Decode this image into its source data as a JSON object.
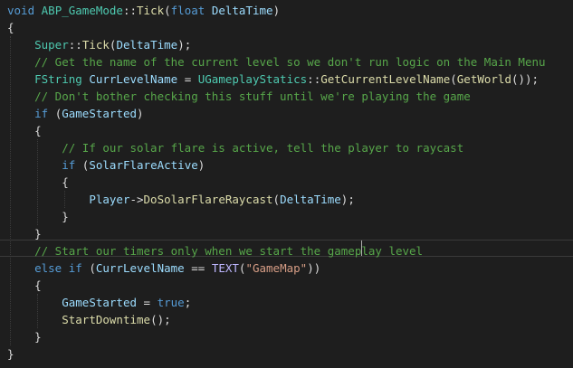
{
  "editor": {
    "cursor_line": 13,
    "lines": [
      [
        {
          "c": "k",
          "t": "void"
        },
        {
          "c": "p",
          "t": " "
        },
        {
          "c": "t",
          "t": "ABP_GameMode"
        },
        {
          "c": "p",
          "t": "::"
        },
        {
          "c": "f",
          "t": "Tick"
        },
        {
          "c": "p",
          "t": "("
        },
        {
          "c": "k",
          "t": "float"
        },
        {
          "c": "p",
          "t": " "
        },
        {
          "c": "v",
          "t": "DeltaTime"
        },
        {
          "c": "p",
          "t": ")"
        }
      ],
      [
        {
          "c": "p",
          "t": "{"
        }
      ],
      [
        {
          "c": "p",
          "t": "    "
        },
        {
          "c": "t",
          "t": "Super"
        },
        {
          "c": "p",
          "t": "::"
        },
        {
          "c": "f",
          "t": "Tick"
        },
        {
          "c": "p",
          "t": "("
        },
        {
          "c": "v",
          "t": "DeltaTime"
        },
        {
          "c": "p",
          "t": ");"
        }
      ],
      [
        {
          "c": "p",
          "t": "    "
        },
        {
          "c": "c",
          "t": "// Get the name of the current level so we don't run logic on the Main Menu"
        }
      ],
      [
        {
          "c": "p",
          "t": "    "
        },
        {
          "c": "t",
          "t": "FString"
        },
        {
          "c": "p",
          "t": " "
        },
        {
          "c": "v",
          "t": "CurrLevelName"
        },
        {
          "c": "p",
          "t": " = "
        },
        {
          "c": "t",
          "t": "UGameplayStatics"
        },
        {
          "c": "p",
          "t": "::"
        },
        {
          "c": "f",
          "t": "GetCurrentLevelName"
        },
        {
          "c": "p",
          "t": "("
        },
        {
          "c": "f",
          "t": "GetWorld"
        },
        {
          "c": "p",
          "t": "());"
        }
      ],
      [
        {
          "c": "p",
          "t": "    "
        },
        {
          "c": "c",
          "t": "// Don't bother checking this stuff until we're playing the game"
        }
      ],
      [
        {
          "c": "p",
          "t": "    "
        },
        {
          "c": "k",
          "t": "if"
        },
        {
          "c": "p",
          "t": " ("
        },
        {
          "c": "v",
          "t": "GameStarted"
        },
        {
          "c": "p",
          "t": ")"
        }
      ],
      [
        {
          "c": "p",
          "t": "    {"
        }
      ],
      [
        {
          "c": "p",
          "t": "        "
        },
        {
          "c": "c",
          "t": "// If our solar flare is active, tell the player to raycast"
        }
      ],
      [
        {
          "c": "p",
          "t": "        "
        },
        {
          "c": "k",
          "t": "if"
        },
        {
          "c": "p",
          "t": " ("
        },
        {
          "c": "v",
          "t": "SolarFlareActive"
        },
        {
          "c": "p",
          "t": ")"
        }
      ],
      [
        {
          "c": "p",
          "t": "        {"
        }
      ],
      [
        {
          "c": "p",
          "t": "            "
        },
        {
          "c": "v",
          "t": "Player"
        },
        {
          "c": "p",
          "t": "->"
        },
        {
          "c": "f",
          "t": "DoSolarFlareRaycast"
        },
        {
          "c": "p",
          "t": "("
        },
        {
          "c": "v",
          "t": "DeltaTime"
        },
        {
          "c": "p",
          "t": ");"
        }
      ],
      [
        {
          "c": "p",
          "t": "        }"
        }
      ],
      [
        {
          "c": "p",
          "t": "    }"
        }
      ],
      [
        {
          "c": "p",
          "t": "    "
        },
        {
          "c": "c",
          "t": "// Start our timers only when we start the gameplay level"
        }
      ],
      [
        {
          "c": "p",
          "t": "    "
        },
        {
          "c": "k",
          "t": "else if"
        },
        {
          "c": "p",
          "t": " ("
        },
        {
          "c": "v",
          "t": "CurrLevelName"
        },
        {
          "c": "p",
          "t": " == "
        },
        {
          "c": "m",
          "t": "TEXT"
        },
        {
          "c": "p",
          "t": "("
        },
        {
          "c": "s",
          "t": "\"GameMap\""
        },
        {
          "c": "p",
          "t": "))"
        }
      ],
      [
        {
          "c": "p",
          "t": "    {"
        }
      ],
      [
        {
          "c": "p",
          "t": "        "
        },
        {
          "c": "v",
          "t": "GameStarted"
        },
        {
          "c": "p",
          "t": " = "
        },
        {
          "c": "k",
          "t": "true"
        },
        {
          "c": "p",
          "t": ";"
        }
      ],
      [
        {
          "c": "p",
          "t": "        "
        },
        {
          "c": "f",
          "t": "StartDowntime"
        },
        {
          "c": "p",
          "t": "();"
        }
      ],
      [
        {
          "c": "p",
          "t": "    }"
        }
      ],
      [
        {
          "c": "p",
          "t": "}"
        }
      ]
    ]
  }
}
